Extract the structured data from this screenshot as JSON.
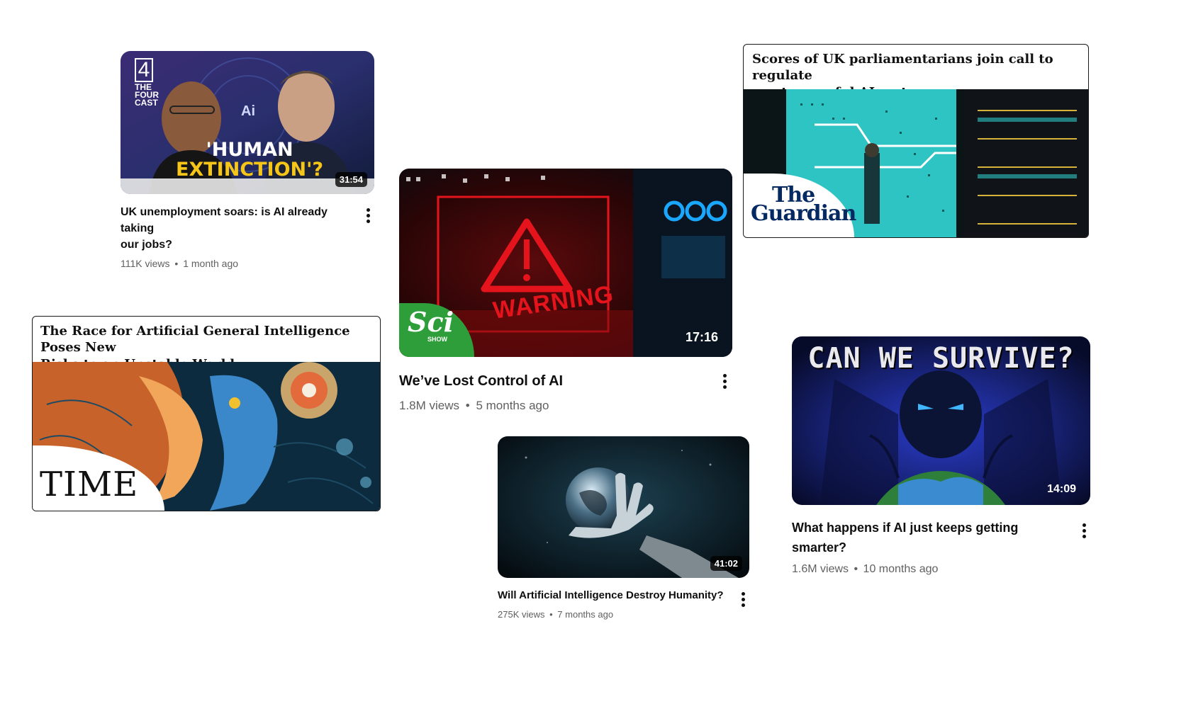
{
  "videos": [
    {
      "title_line1": "UK unemployment soars: is AI already taking",
      "title_line2": "our jobs?",
      "views": "111K views",
      "age": "1 month ago",
      "duration": "31:54",
      "channel_logo": "4",
      "channel_logo_sub": "THE FOUR CAST",
      "thumb_text_1": "'HUMAN",
      "thumb_text_2": "EXTINCTION'?",
      "thumb_badge": "Ai"
    },
    {
      "title_line1": "We’ve Lost Control of AI",
      "views": "1.8M views",
      "age": "5 months ago",
      "duration": "17:16",
      "thumb_text": "WARNING",
      "channel_logo": "Sci",
      "channel_logo_sub": "SHOW"
    },
    {
      "title_line1": "Will Artificial Intelligence Destroy Humanity?",
      "views": "275K views",
      "age": "7 months ago",
      "duration": "41:02"
    },
    {
      "title_line1": "What happens if AI just keeps getting",
      "title_line2": "smarter?",
      "views": "1.6M views",
      "age": "10 months ago",
      "duration": "14:09",
      "thumb_text": "CAN WE SURVIVE?"
    }
  ],
  "articles": [
    {
      "headline_line1": "Scores of UK parliamentarians join call to regulate",
      "headline_line2": "most powerful AI systems",
      "logo_line1": "The",
      "logo_line2": "Guardian"
    },
    {
      "headline_line1": "The Race for Artificial General Intelligence Poses New",
      "headline_line2": "Risks to an Unstable World",
      "logo": "TIME"
    }
  ],
  "separator": "•",
  "colors": {
    "guardian_navy": "#052962",
    "scishow_green": "#2e9e3a",
    "warning_red": "#e5141c",
    "extinction_yellow": "#f5c518"
  }
}
